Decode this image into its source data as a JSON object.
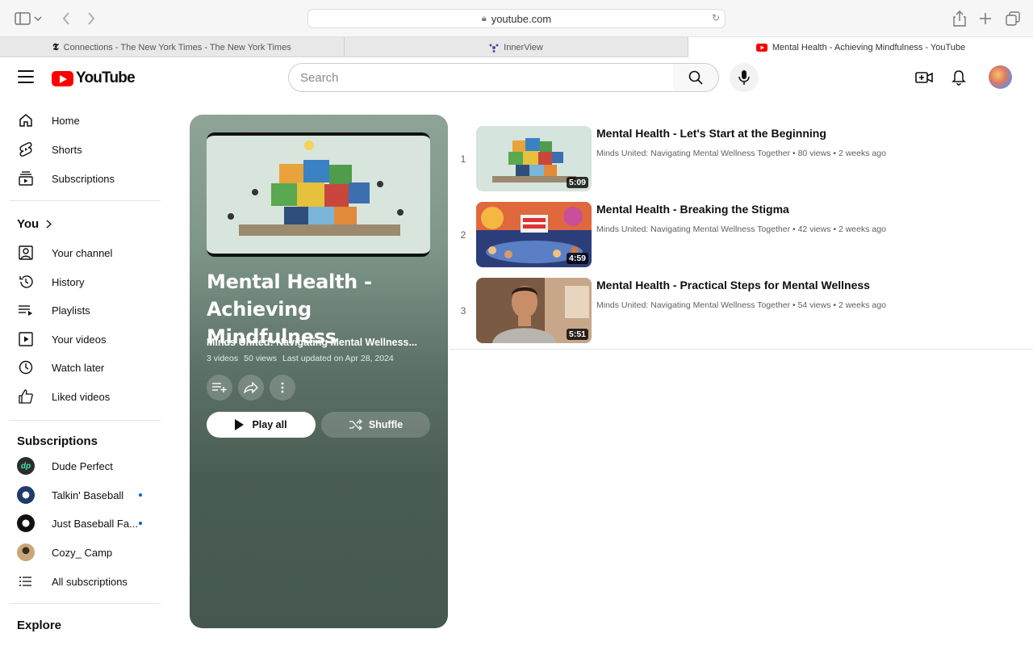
{
  "browser": {
    "url": "youtube.com",
    "tabs": [
      {
        "label": "Connections - The New York Times - The New York Times",
        "favicon": "nyt-icon",
        "active": false
      },
      {
        "label": "InnerView",
        "favicon": "innerview-icon",
        "active": false
      },
      {
        "label": "Mental Health - Achieving Mindfulness - YouTube",
        "favicon": "youtube-icon",
        "active": true
      }
    ]
  },
  "header": {
    "logo_text": "YouTube",
    "search_placeholder": "Search"
  },
  "sidebar": {
    "main": [
      {
        "label": "Home",
        "icon": "home-icon"
      },
      {
        "label": "Shorts",
        "icon": "shorts-icon"
      },
      {
        "label": "Subscriptions",
        "icon": "subscriptions-icon"
      }
    ],
    "you_title": "You",
    "you": [
      {
        "label": "Your channel",
        "icon": "your-channel-icon"
      },
      {
        "label": "History",
        "icon": "history-icon"
      },
      {
        "label": "Playlists",
        "icon": "playlists-icon"
      },
      {
        "label": "Your videos",
        "icon": "your-videos-icon"
      },
      {
        "label": "Watch later",
        "icon": "watch-later-icon"
      },
      {
        "label": "Liked videos",
        "icon": "liked-videos-icon"
      }
    ],
    "subscriptions_title": "Subscriptions",
    "subscriptions": [
      {
        "label": "Dude Perfect",
        "new": false
      },
      {
        "label": "Talkin' Baseball",
        "new": true
      },
      {
        "label": "Just Baseball Fa...",
        "new": true
      },
      {
        "label": "Cozy_ Camp",
        "new": false
      }
    ],
    "all_subscriptions": "All subscriptions",
    "explore_title": "Explore"
  },
  "playlist": {
    "title": "Mental Health - Achieving Mindfulness",
    "owner": "Minds United: Navigating Mental Wellness...",
    "video_count": "3 videos",
    "views": "50 views",
    "updated": "Last updated on Apr 28, 2024",
    "play_all": "Play all",
    "shuffle": "Shuffle"
  },
  "videos": [
    {
      "index": "1",
      "title": "Mental Health - Let's Start at the Beginning",
      "channel": "Minds United: Navigating Mental Wellness Together",
      "views": "80 views",
      "age": "2 weeks ago",
      "duration": "5:09"
    },
    {
      "index": "2",
      "title": "Mental Health - Breaking the Stigma",
      "channel": "Minds United: Navigating Mental Wellness Together",
      "views": "42 views",
      "age": "2 weeks ago",
      "duration": "4:59"
    },
    {
      "index": "3",
      "title": "Mental Health - Practical Steps for Mental Wellness",
      "channel": "Minds United: Navigating Mental Wellness Together",
      "views": "54 views",
      "age": "2 weeks ago",
      "duration": "5:51"
    }
  ],
  "colors": {
    "accent": "#ff0000",
    "panel": "#4a5d54",
    "notification_dot": "#065fd4"
  }
}
